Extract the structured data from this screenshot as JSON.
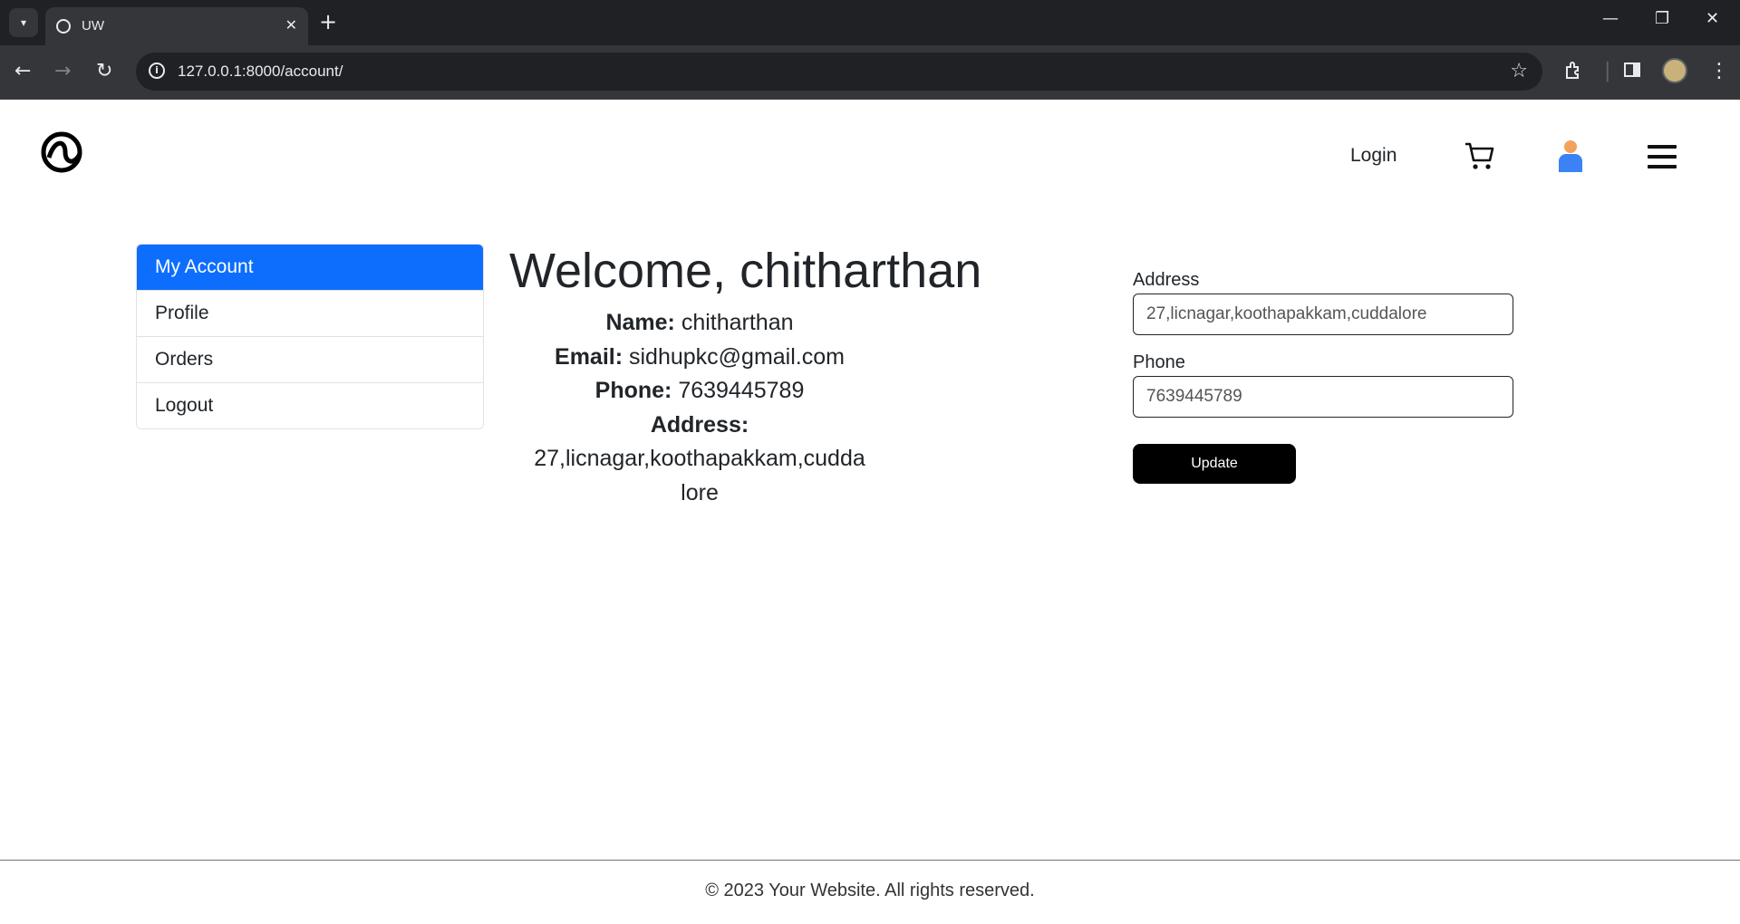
{
  "browser": {
    "tab_title": "UW",
    "tab_close": "✕",
    "new_tab": "+",
    "url": "127.0.0.1:8000/account/",
    "info_glyph": "i",
    "icons": {
      "tab_search": "chevron-down-icon",
      "back": "back-arrow-icon",
      "forward": "forward-arrow-icon",
      "reload": "reload-icon",
      "star": "bookmark-star-icon",
      "extensions": "puzzle-icon",
      "side_panel": "side-panel-icon",
      "menu": "kebab-menu-icon"
    },
    "window_controls": {
      "minimize": "—",
      "restore": "❐",
      "close": "✕"
    }
  },
  "nav": {
    "login": "Login",
    "icons": [
      "cart-icon",
      "user-icon",
      "hamburger-menu-icon"
    ]
  },
  "sidebar": {
    "items": [
      {
        "label": "My Account",
        "active": true
      },
      {
        "label": "Profile",
        "active": false
      },
      {
        "label": "Orders",
        "active": false
      },
      {
        "label": "Logout",
        "active": false
      }
    ]
  },
  "main": {
    "welcome": "Welcome, chitharthan",
    "name_label": "Name:",
    "name": "chitharthan",
    "email_label": "Email:",
    "email": "sidhupkc@gmail.com",
    "phone_label": "Phone:",
    "phone": "7639445789",
    "address_label": "Address:",
    "address_line1": "27,licnagar,koothapakkam,cudda",
    "address_line2": "lore"
  },
  "form": {
    "address_label": "Address",
    "address_value": "27,licnagar,koothapakkam,cuddalore",
    "phone_label": "Phone",
    "phone_value": "7639445789",
    "update_label": "Update"
  },
  "footer": {
    "text": "© 2023 Your Website. All rights reserved."
  },
  "colors": {
    "active_item": "#0d6efd",
    "update_button": "#000000",
    "user_icon_head": "#f4a259",
    "user_icon_body": "#3b82f6"
  }
}
